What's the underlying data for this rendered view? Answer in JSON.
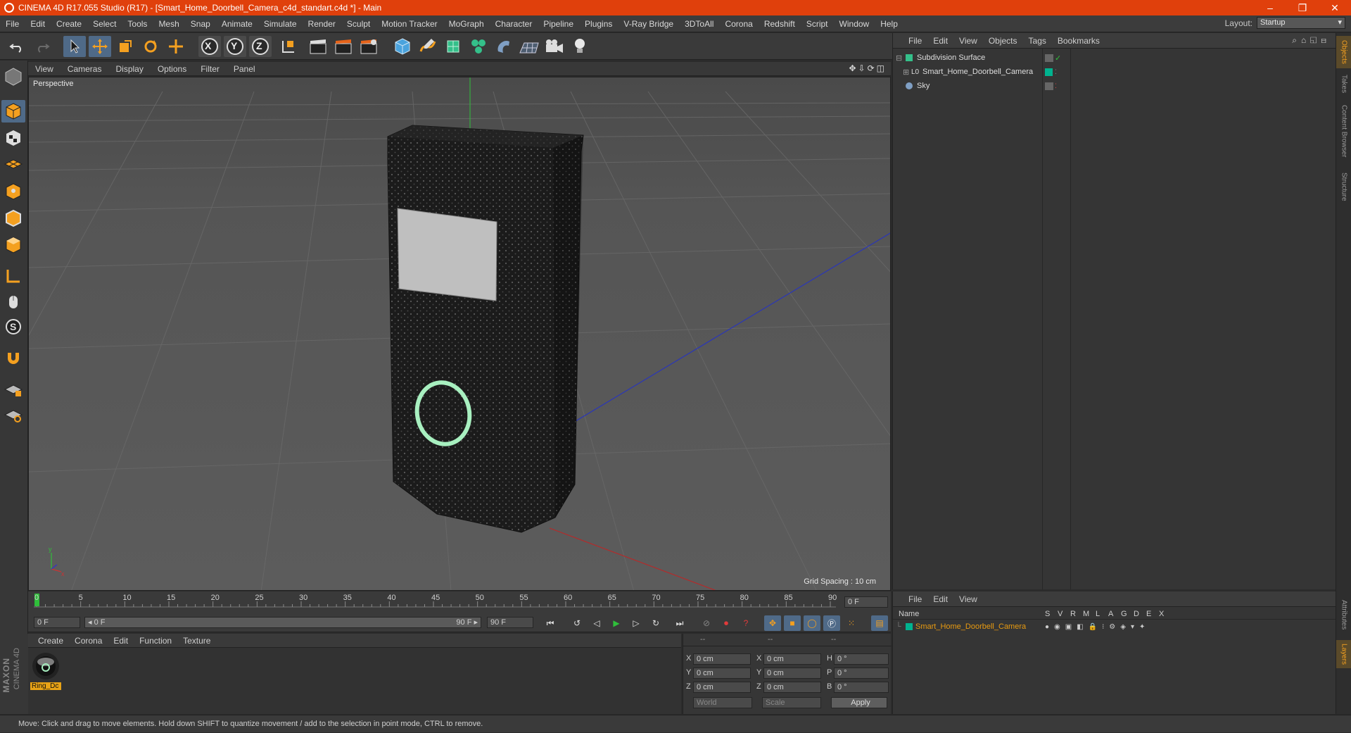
{
  "window": {
    "title": "CINEMA 4D R17.055 Studio (R17) - [Smart_Home_Doorbell_Camera_c4d_standart.c4d *] - Main",
    "controls": [
      "–",
      "❐",
      "✕"
    ]
  },
  "menu": [
    "File",
    "Edit",
    "Create",
    "Select",
    "Tools",
    "Mesh",
    "Snap",
    "Animate",
    "Simulate",
    "Render",
    "Sculpt",
    "Motion Tracker",
    "MoGraph",
    "Character",
    "Pipeline",
    "Plugins",
    "V-Ray Bridge",
    "3DToAll",
    "Corona",
    "Redshift",
    "Script",
    "Window",
    "Help"
  ],
  "layout": {
    "label": "Layout:",
    "value": "Startup"
  },
  "toolbar": {
    "axis_x": "X",
    "axis_y": "Y",
    "axis_z": "Z"
  },
  "viewport": {
    "menu": [
      "View",
      "Cameras",
      "Display",
      "Options",
      "Filter",
      "Panel"
    ],
    "label": "Perspective",
    "grid_spacing": "Grid Spacing : 10 cm"
  },
  "timeline": {
    "ticks": [
      "0",
      "5",
      "10",
      "15",
      "20",
      "25",
      "30",
      "35",
      "40",
      "45",
      "50",
      "55",
      "60",
      "65",
      "70",
      "75",
      "80",
      "85",
      "90"
    ],
    "current_frame_field": "0 F",
    "start_field": "0 F",
    "range_start": "◂ 0 F",
    "range_end": "90 F ▸",
    "end_field": "90 F"
  },
  "materials": {
    "menu": [
      "Create",
      "Corona",
      "Edit",
      "Function",
      "Texture"
    ],
    "items": [
      {
        "name": "Ring_Dc"
      }
    ]
  },
  "attributes": {
    "headers": [
      "--",
      "--",
      "--"
    ],
    "rows": [
      {
        "l1": "X",
        "v1": "0 cm",
        "l2": "X",
        "v2": "0 cm",
        "l3": "H",
        "v3": "0 °"
      },
      {
        "l1": "Y",
        "v1": "0 cm",
        "l2": "Y",
        "v2": "0 cm",
        "l3": "P",
        "v3": "0 °"
      },
      {
        "l1": "Z",
        "v1": "0 cm",
        "l2": "Z",
        "v2": "0 cm",
        "l3": "B",
        "v3": "0 °"
      }
    ],
    "coord_mode": "World",
    "size_mode": "Scale",
    "apply": "Apply"
  },
  "objects": {
    "menu": [
      "File",
      "Edit",
      "View",
      "Objects",
      "Tags",
      "Bookmarks"
    ],
    "rows": [
      {
        "name": "Subdivision Surface",
        "icon": "subdivision-icon",
        "color": "#34c08a"
      },
      {
        "name": "Smart_Home_Doorbell_Camera",
        "icon": "null-object-icon",
        "color": "#00b38f"
      },
      {
        "name": "Sky",
        "icon": "sky-icon",
        "color": "#7f9fc4"
      }
    ]
  },
  "layers": {
    "menu": [
      "File",
      "Edit",
      "View"
    ],
    "columns": [
      "Name",
      "S",
      "V",
      "R",
      "M",
      "L",
      "A",
      "G",
      "D",
      "E",
      "X"
    ],
    "rows": [
      {
        "name": "Smart_Home_Doorbell_Camera",
        "color": "#e89a10"
      }
    ]
  },
  "side_tabs": [
    "Objects",
    "Takes",
    "Content Browser",
    "Structure"
  ],
  "side_tabs_bottom": [
    "Attributes",
    "Layers"
  ],
  "brand": {
    "maxon": "MAXON",
    "c4d": "CINEMA 4D"
  },
  "status": "Move: Click and drag to move elements. Hold down SHIFT to quantize movement / add to the selection in point mode, CTRL to remove.",
  "colors": {
    "titlebar": "#e0400c",
    "accent": "#4f6a88",
    "ring": "#a8f0c0"
  }
}
